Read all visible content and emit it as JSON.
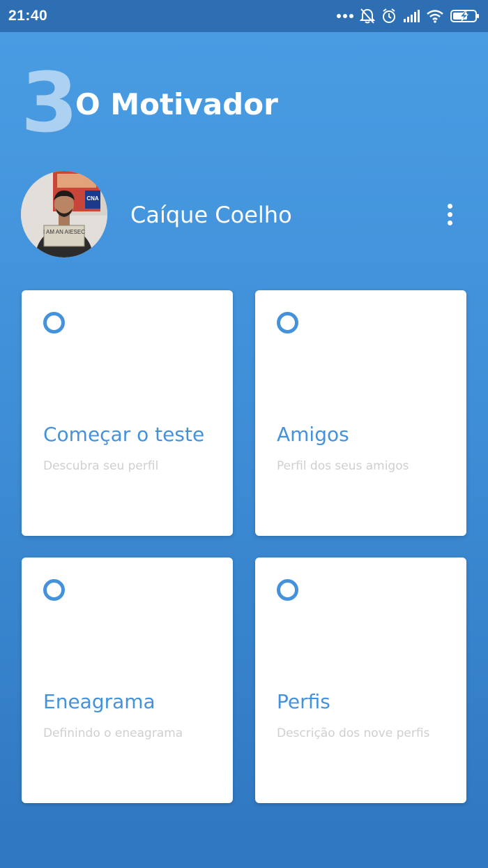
{
  "status_bar": {
    "time": "21:40",
    "icons": [
      "more-dots-icon",
      "notifications-off-icon",
      "alarm-icon",
      "signal-icon",
      "wifi-icon",
      "battery-charging-icon"
    ]
  },
  "header": {
    "logo_number": "3",
    "app_title": "O Motivador"
  },
  "profile": {
    "name": "Caíque Coelho",
    "avatar_sign_text": "I AM AN AIESEC",
    "avatar_poster_text": "CNA",
    "menu_icon": "more-vert-icon"
  },
  "cards": [
    {
      "title": "Começar o teste",
      "subtitle": "Descubra seu perfil",
      "icon": "ring-icon"
    },
    {
      "title": "Amigos",
      "subtitle": "Perfil dos seus amigos",
      "icon": "ring-icon"
    },
    {
      "title": "Eneagrama",
      "subtitle": "Definindo o eneagrama",
      "icon": "ring-icon"
    },
    {
      "title": "Perfis",
      "subtitle": "Descrição dos nove perfis",
      "icon": "ring-icon"
    }
  ],
  "colors": {
    "background_top": "#4a9de3",
    "background_bottom": "#2f77c0",
    "status_bar": "#2d6fb2",
    "accent": "#4592dc",
    "subtitle": "#cfcfcf"
  }
}
